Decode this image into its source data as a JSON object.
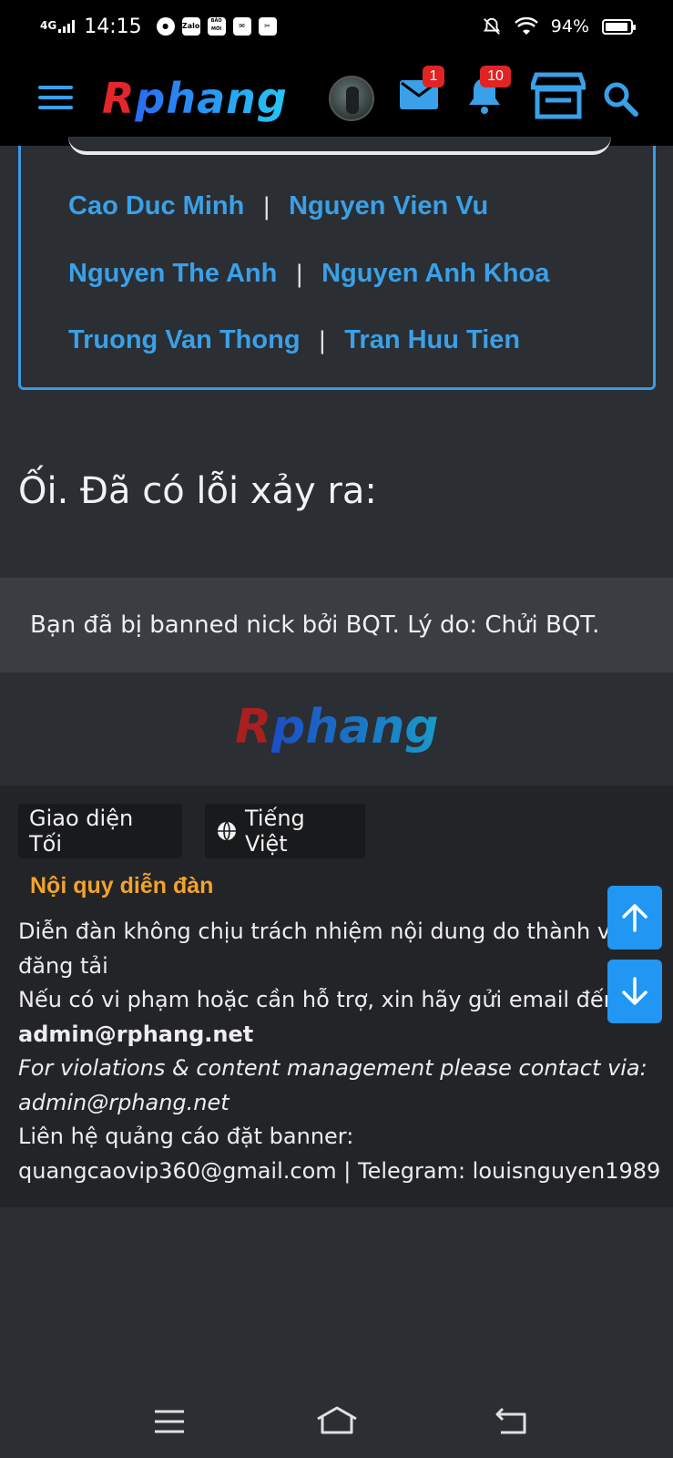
{
  "status_bar": {
    "network": "4G",
    "time": "14:15",
    "battery_percent": "94%",
    "app_icons": [
      "chrome-icon",
      "zalo-icon",
      "baomoi-icon",
      "mail-icon",
      "capcut-icon"
    ],
    "app_icon_labels": {
      "zalo": "Zalo",
      "baomoi": "BÁO MỚI"
    },
    "battery_level": 0.94
  },
  "navbar": {
    "logo": "Rphang",
    "mail_badge": "1",
    "notification_badge": "10",
    "accent_color": "#3aa0e8"
  },
  "members": {
    "rows": [
      [
        "Cao Duc Minh",
        "Nguyen Vien Vu"
      ],
      [
        "Nguyen The Anh",
        "Nguyen Anh Khoa"
      ],
      [
        "Truong Van Thong",
        "Tran Huu Tien"
      ]
    ],
    "separator": "|"
  },
  "error": {
    "title": "Ối. Đã có lỗi xảy ra:",
    "message": "Bạn đã bị banned nick bởi BQT. Lý do: Chửi BQT."
  },
  "footer": {
    "logo": "Rphang",
    "theme_button": "Giao diện Tối",
    "language_button": "Tiếng Việt",
    "rules_title": "Nội quy diễn đàn",
    "lines": {
      "l1": "Diễn đàn không chịu trách nhiệm nội dung do thành viên",
      "l2": "đăng tải",
      "l3": "Nếu có vi phạm hoặc cần hỗ trợ, xin hãy gửi email đến:",
      "l4": "admin@rphang.net",
      "l5": "For violations & content management please contact via:",
      "l6": "admin@rphang.net",
      "l7": "Liên hệ quảng cáo đặt banner:",
      "l8": "quangcaovip360@gmail.com | Telegram: louisnguyen1989"
    }
  },
  "colors": {
    "background": "#2b2e33",
    "footer_bg": "#222427",
    "rules_title": "#f4a32a",
    "scroll_button": "#2196f3",
    "badge": "#e02424"
  }
}
